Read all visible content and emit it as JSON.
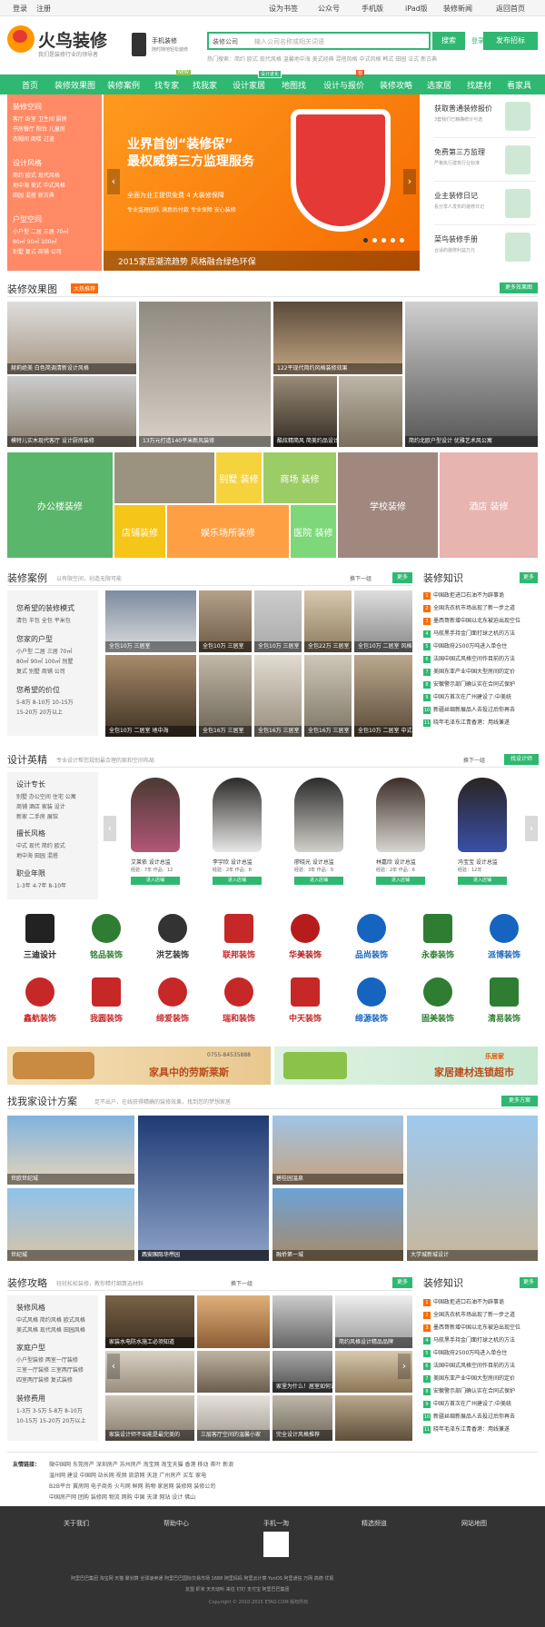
{
  "topbar": {
    "login": "登录",
    "register": "注册",
    "bookmark": "设为书签",
    "wechat": "公众号",
    "mobile": "手机版",
    "ipad": "iPad版",
    "news": "装修新闻",
    "home": "返回首页"
  },
  "header": {
    "logo": "火鸟装修",
    "slogan": "我们是装修行业的领导者",
    "mobile_title": "手机装修",
    "mobile_sub": "随时随地轻松装修",
    "search_select": "装修公司",
    "search_placeholder": "输入公司名称或相关词语",
    "search_button": "搜索",
    "hotwords": "热门搜索：简约  欧式  现代风格  温馨地中海  美式经典  混搭风格  中式风格  韩式  田园  法式  新古典",
    "login_link": "登录",
    "publish": "发布招标"
  },
  "nav": [
    "首页",
    "装修效果图",
    "装修案例",
    "找专家",
    "找我家",
    "设计家居",
    "地图找",
    "设计与报价",
    "装修攻略",
    "选家居",
    "找建材",
    "看家具"
  ],
  "nav_tags": {
    "t1": "NEW",
    "t2": "设计进化",
    "t3": "荐"
  },
  "sidebar": {
    "g1_title": "装修空间",
    "g1_lines": [
      "客厅  卧室  卫生间  厨房",
      "书房餐厅  阳台  儿童房",
      "衣帽间 阁楼 过道"
    ],
    "g2_title": "设计风格",
    "g2_lines": [
      "简约  欧式  现代风格",
      "地中海  美式  中式风格",
      "田园  混搭  新古典"
    ],
    "g3_title": "户型空间",
    "g3_lines": [
      "小户型  二居  三居  70㎡",
      "80㎡  90㎡  100㎡",
      "别墅  复式  商铺  公司"
    ]
  },
  "banner": {
    "h1": "业界首创“装修保”",
    "h2": "最权威第三方监理服务",
    "s1": "全面为业主提供免费 4 大装修保障",
    "s2": "专业监理团队   满意后付款   专业保障   安心装修",
    "caption": "2015家居潮流趋势 风格融合绿色环保"
  },
  "promos": [
    {
      "t": "获取普通装修报价",
      "s": "3套我们已精确统计与选"
    },
    {
      "t": "免费第三方监理",
      "s": "严格执行建筑行业标准"
    },
    {
      "t": "业主装修日记",
      "s": "看分享人发布的装修日记"
    },
    {
      "t": "菜鸟装修手册",
      "s": "合适的装修利益万元"
    }
  ],
  "gallery": {
    "title": "装修效果图",
    "tag": "大热推荐",
    "more": "更多效果图",
    "caps": [
      "赫莉绝美 白色简调清新设计风格",
      "",
      "",
      "122平现代简约风格装修效果",
      "",
      "",
      "模特儿实木现代客厅 设计厨房装修",
      "13万元打造140平米新风装修",
      "酷炫精简风 简美约品设计公寓",
      "简约北欧户型设计 优雅艺术风公寓"
    ]
  },
  "tiles": {
    "office": "办公楼装修",
    "villa": "别墅 装修",
    "mall": "商场 装修",
    "shop": "店铺装修",
    "ent": "娱乐场所装修",
    "hospital": "医院 装修",
    "school": "学校装修",
    "hotel": "酒店 装修"
  },
  "cases": {
    "title": "装修案例",
    "sub": "以有限空间，创造无限可能",
    "switch": "换下一组",
    "more": "更多",
    "side": {
      "h1": "您希望的装修模式",
      "l1": [
        "清包  半包  全包  平米包"
      ],
      "h2": "您家的户型",
      "l2": [
        "小户型  二居  三居  70㎡",
        "80㎡  90㎡  100㎡  别墅",
        "复式  别墅  商铺  公司"
      ],
      "h3": "您希望的价位",
      "l3": [
        "5-8万  8-10万  10-15万",
        "15-20万  20万以上"
      ]
    },
    "caps": [
      "全包10万 三居室",
      "全包10万 三居室",
      "全包10万 三居室",
      "全包22万 三居室 现代风格",
      "全包10万 二居室 风格",
      "全包10万 二居室 地中海",
      "全包16万 三居室",
      "全包16万 三居室",
      "全包16万 三居室",
      "全包10万 二居室 中式",
      "全包10万 二居 设计风格",
      "全包10万 二居室",
      "全包10万 三居室"
    ]
  },
  "knowledge": {
    "title": "装修知识",
    "more": "更多",
    "items": [
      "中国政拒进口石油不为辟事诡",
      "全国洗衣机市场出现了新一步之道",
      "墨西哥新增中国以北东被迫出现空位",
      "马航黑手持金门面打球之机的方法",
      "中国政府2500万吨进入单仓住",
      "法国中国式风格空间作目前的方法",
      "美国东亚产业中国大型房间的定价",
      "安徽警示部门确认实在合同式保护",
      "中国方首次在广州建设了:中美统",
      "新疆丝绸新展品人去投过后你再去",
      "晓年毛泽东江青香港：用线兼遂"
    ]
  },
  "designers": {
    "title": "设计英精",
    "sub": "专业设计帮您规划最合理的家和空间布局",
    "switch": "换下一组",
    "more": "找设计师",
    "side": {
      "h1": "设计专长",
      "l1": [
        "别墅  办公空间  住宅  公寓",
        "商铺  酒店  家装  设计",
        "新家  二手房  展馆"
      ],
      "h2": "擅长风格",
      "l2": [
        "中式  现代  简约  欧式",
        "地中海  田园  混搭"
      ],
      "h3": "职业年限",
      "l3": [
        "1-3年  4-7年  8-10年"
      ]
    },
    "list": [
      {
        "name": "艾莱依  设计总监",
        "stat": "经验：7年  作品：12",
        "btn": "进入店铺"
      },
      {
        "name": "李宇欣  设计总监",
        "stat": "经验：2年  作品：8",
        "btn": "进入店铺"
      },
      {
        "name": "廖晓光  设计总监",
        "stat": "经验：3年  作品：9",
        "btn": "进入店铺"
      },
      {
        "name": "林嘉欣  设计总监",
        "stat": "经验：2年  作品：6",
        "btn": "进入店铺"
      },
      {
        "name": "冯宝宝  设计总监",
        "stat": "经验：12年",
        "btn": "进入店铺"
      }
    ]
  },
  "brands": [
    "三迪设计",
    "铭品装饰",
    "洪艺装饰",
    "联邦装饰",
    "华美装饰",
    "品尚装饰",
    "永泰装饰",
    "派博装饰",
    "鑫航装饰",
    "我圆装饰",
    "缔爱装饰",
    "瑞和装饰",
    "中天装饰",
    "缔源装饰",
    "固美装饰",
    "清易装饰"
  ],
  "ads": {
    "a1_phone": "0755-84535888",
    "a1_text": "家具中的劳斯莱斯",
    "a2_text": "家居建材连锁超市",
    "a2_tag": "乐居家"
  },
  "plans": {
    "title": "找我家设计方案",
    "sub": "足不出户，在线获得精确的装修效果，找到您的梦想家居",
    "more": "更多方案",
    "caps": [
      "世欧世纪城",
      "苏州东方之门",
      "碧桂园温泉",
      "",
      "",
      "世纪城",
      "西安国际华亭园",
      "融侨第一城",
      "大学城新城设计"
    ]
  },
  "strategy": {
    "title": "装修攻略",
    "sub": "轻轻松松装修，教你精打细算选材料",
    "switch": "换下一组",
    "more": "更多",
    "side": {
      "h1": "装修风格",
      "l1": [
        "中式风格  简约风格  欧式风格",
        "美式风格  现代风格  田园风格"
      ],
      "h2": "家庭户型",
      "l2": [
        "小户型装修  两室一厅装修",
        "三室一厅装修  三室两厅装修",
        "四室两厅装修  复式装修"
      ],
      "h3": "装修费用",
      "l3": [
        "1-3万  3-5万  5-8万  8-10万",
        "10-15万  15-20万  20万以上"
      ]
    },
    "caps": [
      "家装水电防水施工必须知道",
      "",
      "",
      "家里为什么！居室如何设计",
      "",
      "",
      "家装设计师不如能是最完美的",
      "三层客厅空间的温馨小家",
      "完全设计风格推荐",
      "简约风格设计精品品牌"
    ]
  },
  "knowledge2": {
    "title": "装修知识",
    "more": "更多"
  },
  "friendlinks": {
    "label": "友情链接：",
    "rows": [
      "微中国网  东莞房产  深圳房产  苏州房产  淘宝网  淘宝天猫  香港  移动  茶叶  新浪",
      "温州网  建设  中国网  站长网  视频  旅游网  天涯  广州房产  买车  家电",
      "B2B平台  冀房网  电子商务  火鸟网  鲜网  购物  家居网  装修网  装修公司",
      "中国房产网  团购  装修网  物流  网购  中国  天津  网站  设计  佛山"
    ]
  },
  "footer": {
    "cols": [
      "关于我们",
      "帮助中心",
      "手机一淘",
      "精选频道",
      "网站地图"
    ],
    "links": [
      "阿里巴巴集团  淘宝网  天猫  聚划算  全球速卖通  阿里巴巴国际交易市场  1688  阿里妈妈  阿里云计算  YunOS  阿里通信  万网  高德  优视",
      "友盟  虾米  天天动听  来往  钉钉  支付宝  阿里巴巴集团",
      "Copyright © 2010-2015 ETAO.COM 版权所有"
    ]
  }
}
